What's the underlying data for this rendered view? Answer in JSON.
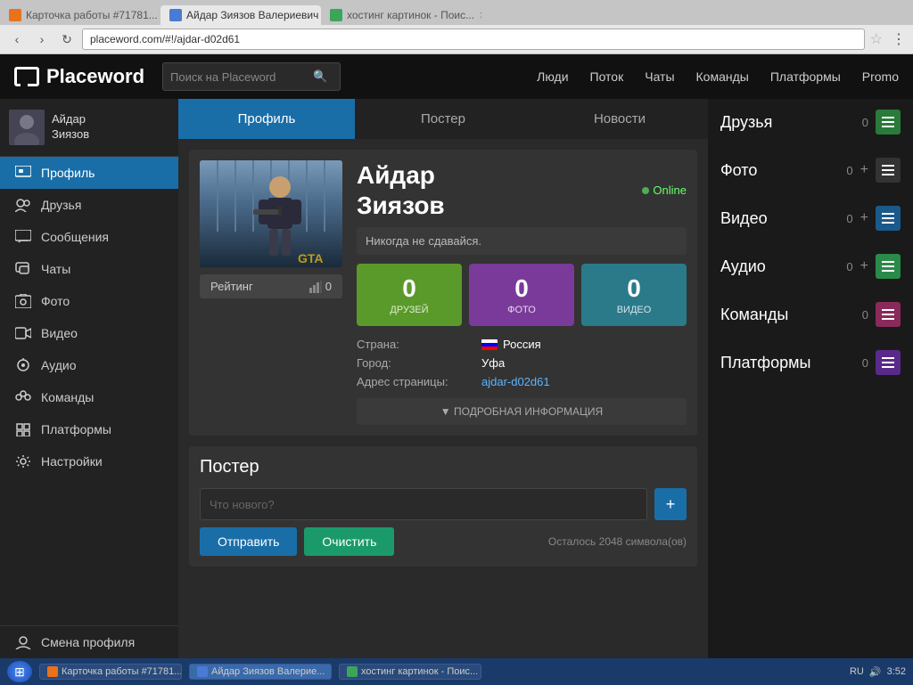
{
  "browser": {
    "tabs": [
      {
        "id": "tab1",
        "label": "Карточка работы #71781...",
        "favicon_color": "orange",
        "active": false
      },
      {
        "id": "tab2",
        "label": "Айдар Зиязов Валериевич",
        "favicon_color": "blue",
        "active": true
      },
      {
        "id": "tab3",
        "label": "хостинг картинок - Поис...",
        "favicon_color": "green",
        "active": false
      }
    ],
    "address": "placeword.com/#!/ajdar-d02d61"
  },
  "topnav": {
    "logo": "Placeword",
    "search_placeholder": "Поиск на Placeword",
    "links": [
      "Люди",
      "Поток",
      "Чаты",
      "Команды",
      "Платформы",
      "Promo"
    ]
  },
  "sidebar": {
    "user": {
      "name": "Айдар\nЗиязов"
    },
    "items": [
      {
        "id": "profile",
        "label": "Профиль",
        "active": true
      },
      {
        "id": "friends",
        "label": "Друзья"
      },
      {
        "id": "messages",
        "label": "Сообщения"
      },
      {
        "id": "chats",
        "label": "Чаты"
      },
      {
        "id": "photo",
        "label": "Фото"
      },
      {
        "id": "video",
        "label": "Видео"
      },
      {
        "id": "audio",
        "label": "Аудио"
      },
      {
        "id": "teams",
        "label": "Команды"
      },
      {
        "id": "platforms",
        "label": "Платформы"
      },
      {
        "id": "settings",
        "label": "Настройки"
      }
    ],
    "footer": [
      {
        "id": "switch-profile",
        "label": "Смена профиля"
      }
    ]
  },
  "profile_tabs": [
    "Профиль",
    "Постер",
    "Новости"
  ],
  "profile": {
    "name": "Айдар\nЗиязов",
    "online_label": "Online",
    "bio": "Никогда не сдавайся.",
    "rating_label": "Рейтинг",
    "rating_value": "0",
    "stats": [
      {
        "count": "0",
        "label": "ДРУЗЕЙ",
        "color": "green"
      },
      {
        "count": "0",
        "label": "ФОТО",
        "color": "purple"
      },
      {
        "count": "0",
        "label": "ВИДЕО",
        "color": "teal"
      }
    ],
    "details": [
      {
        "key": "Страна:",
        "value": "Россия",
        "has_flag": true
      },
      {
        "key": "Город:",
        "value": "Уфа",
        "has_flag": false
      },
      {
        "key": "Адрес страницы:",
        "value": "ajdar-d02d61",
        "is_link": true
      }
    ],
    "more_info_label": "▼  ПОДРОБНАЯ ИНФОРМАЦИЯ"
  },
  "poster": {
    "title": "Постер",
    "input_placeholder": "Что нового?",
    "btn_send": "Отправить",
    "btn_clear": "Очистить",
    "chars_left": "Осталось 2048 символа(ов)"
  },
  "right_widgets": [
    {
      "id": "friends",
      "title": "Друзья",
      "count": "0",
      "menu_class": "friends",
      "has_add": false
    },
    {
      "id": "photo",
      "title": "Фото",
      "count": "0",
      "menu_class": "photo",
      "has_add": true
    },
    {
      "id": "video",
      "title": "Видео",
      "count": "0",
      "menu_class": "video",
      "has_add": true
    },
    {
      "id": "audio",
      "title": "Аудио",
      "count": "0",
      "menu_class": "audio",
      "has_add": true
    },
    {
      "id": "teams",
      "title": "Команды",
      "count": "0",
      "menu_class": "teams",
      "has_add": false
    },
    {
      "id": "platforms",
      "title": "Платформы",
      "count": "0",
      "menu_class": "platforms",
      "has_add": false
    }
  ],
  "taskbar": {
    "items": [
      {
        "label": "Карточка работы #71781...",
        "favicon": "orange",
        "active": false
      },
      {
        "label": "Айдар Зиязов Валерие...",
        "favicon": "blue",
        "active": true
      },
      {
        "label": "хостинг картинок - Поис...",
        "favicon": "green",
        "active": false
      }
    ],
    "tray": {
      "lang": "RU",
      "time": "3:52"
    }
  }
}
